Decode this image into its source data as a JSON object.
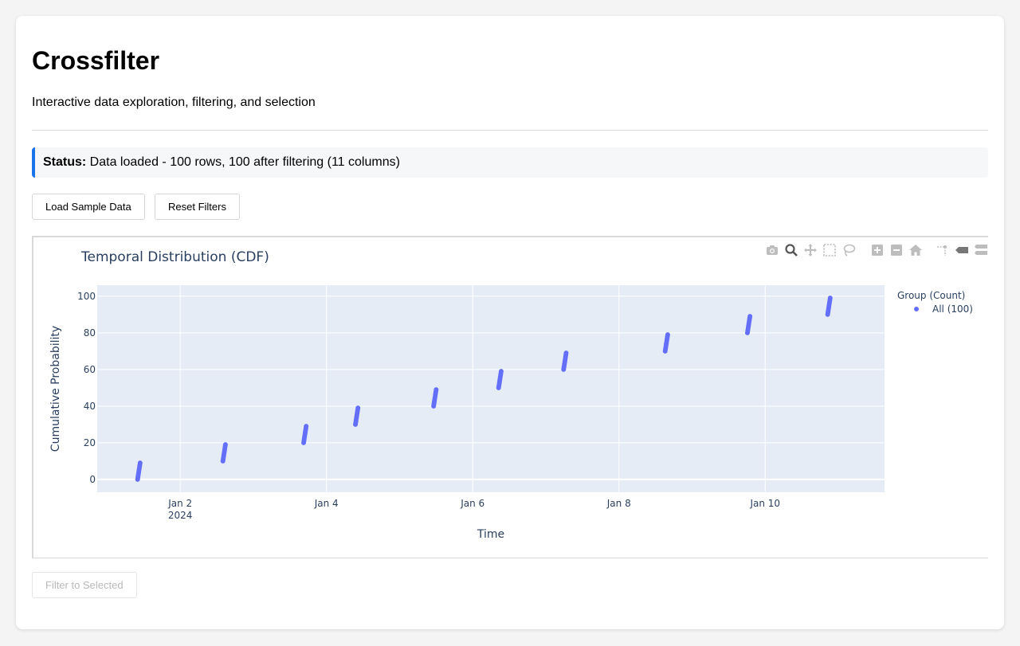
{
  "page": {
    "title": "Crossfilter",
    "subtitle": "Interactive data exploration, filtering, and selection"
  },
  "status": {
    "label": "Status:",
    "text": " Data loaded - 100 rows, 100 after filtering (11 columns)"
  },
  "buttons": {
    "load_sample": "Load Sample Data",
    "reset_filters": "Reset Filters",
    "filter_selected": "Filter to Selected"
  },
  "modebar": {
    "icons": [
      "camera-icon",
      "zoom-icon",
      "pan-icon",
      "box-select-icon",
      "lasso-select-icon",
      "zoom-in-icon",
      "zoom-out-icon",
      "reset-axes-icon",
      "spike-lines-icon",
      "hover-closest-icon",
      "hover-compare-icon"
    ]
  },
  "chart_data": {
    "type": "scatter",
    "title": "Temporal Distribution (CDF)",
    "xlabel": "Time",
    "ylabel": "Cumulative Probability",
    "x_ticks": [
      {
        "date": "2024-01-02",
        "label": "Jan 2",
        "sublabel": "2024"
      },
      {
        "date": "2024-01-04",
        "label": "Jan 4",
        "sublabel": ""
      },
      {
        "date": "2024-01-06",
        "label": "Jan 6",
        "sublabel": ""
      },
      {
        "date": "2024-01-08",
        "label": "Jan 8",
        "sublabel": ""
      },
      {
        "date": "2024-01-10",
        "label": "Jan 10",
        "sublabel": ""
      }
    ],
    "y_ticks": [
      0,
      20,
      40,
      60,
      80,
      100
    ],
    "xlim": [
      "2023-12-31 20:45",
      "2024-01-11 15:10"
    ],
    "ylim": [
      -7,
      106
    ],
    "grid": true,
    "legend": {
      "title": "Group (Count)",
      "placement": "right"
    },
    "series": [
      {
        "name": "All (100)",
        "color": "#636efa",
        "clusters": [
          {
            "x_start": "2024-01-01 10:00",
            "x_end": "2024-01-01 10:50",
            "y_start": 0,
            "y_end": 9
          },
          {
            "x_start": "2024-01-02 14:00",
            "x_end": "2024-01-02 14:50",
            "y_start": 10,
            "y_end": 19
          },
          {
            "x_start": "2024-01-03 16:30",
            "x_end": "2024-01-03 17:20",
            "y_start": 20,
            "y_end": 29
          },
          {
            "x_start": "2024-01-04 09:30",
            "x_end": "2024-01-04 10:20",
            "y_start": 30,
            "y_end": 39
          },
          {
            "x_start": "2024-01-05 11:10",
            "x_end": "2024-01-05 12:00",
            "y_start": 40,
            "y_end": 49
          },
          {
            "x_start": "2024-01-06 08:30",
            "x_end": "2024-01-06 09:20",
            "y_start": 50,
            "y_end": 59
          },
          {
            "x_start": "2024-01-07 05:50",
            "x_end": "2024-01-07 06:40",
            "y_start": 60,
            "y_end": 69
          },
          {
            "x_start": "2024-01-08 15:10",
            "x_end": "2024-01-08 16:00",
            "y_start": 70,
            "y_end": 79
          },
          {
            "x_start": "2024-01-09 18:10",
            "x_end": "2024-01-09 19:00",
            "y_start": 80,
            "y_end": 89
          },
          {
            "x_start": "2024-01-10 20:30",
            "x_end": "2024-01-10 21:20",
            "y_start": 90,
            "y_end": 99
          }
        ]
      }
    ]
  }
}
